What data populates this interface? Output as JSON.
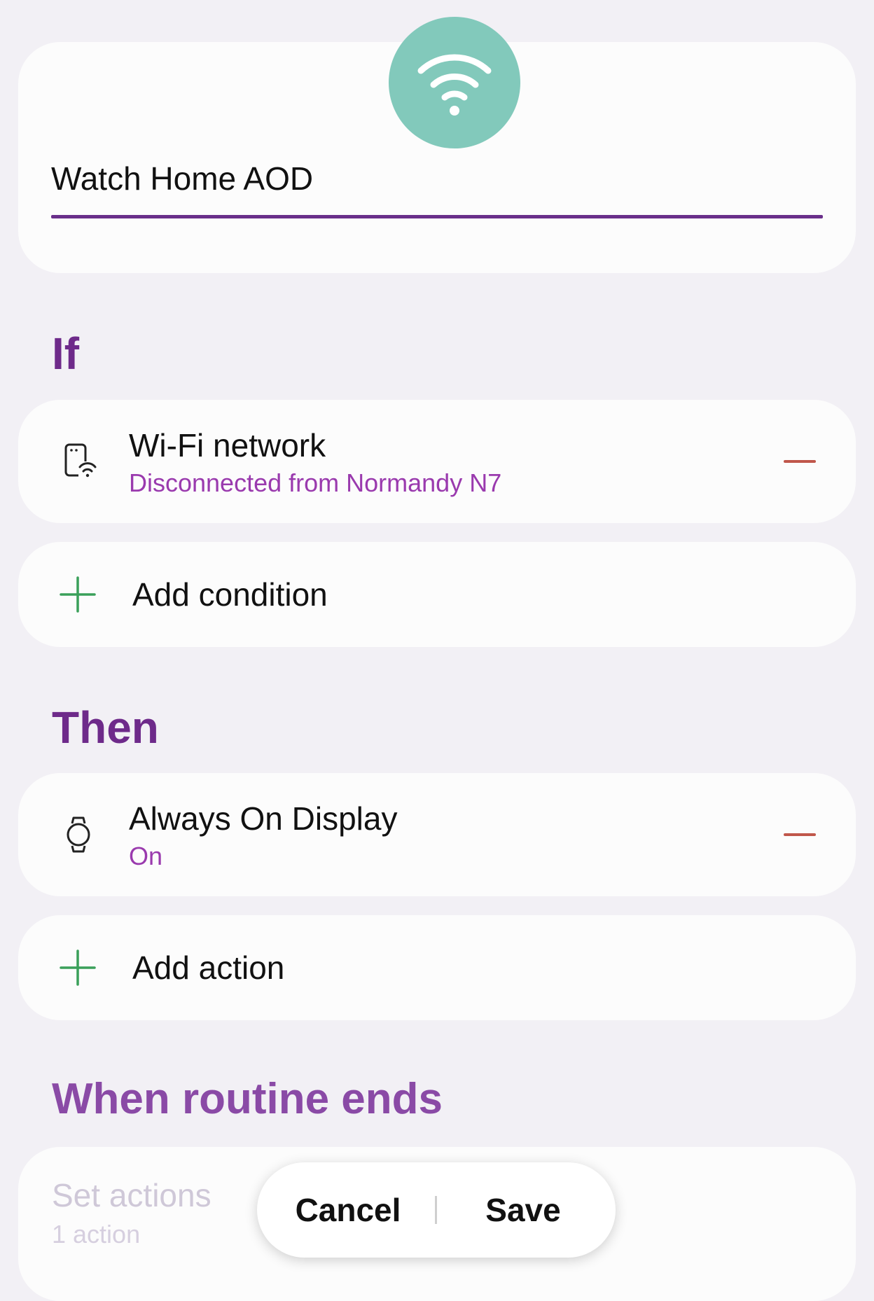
{
  "routine": {
    "icon": "wifi-icon",
    "icon_color": "#82c9bb",
    "name": "Watch Home AOD"
  },
  "if_section": {
    "heading": "If",
    "condition": {
      "icon": "phone-wifi-icon",
      "title": "Wi-Fi network",
      "subtitle": "Disconnected from Normandy N7"
    },
    "add_label": "Add condition"
  },
  "then_section": {
    "heading": "Then",
    "action": {
      "icon": "watch-icon",
      "title": "Always On Display",
      "subtitle": "On"
    },
    "add_label": "Add action"
  },
  "ends_section": {
    "heading": "When routine ends",
    "title": "Set actions",
    "subtitle": "1 action"
  },
  "bottom_bar": {
    "cancel_label": "Cancel",
    "save_label": "Save"
  },
  "colors": {
    "accent": "#6e2a8a",
    "subtitle": "#9a3aae",
    "remove": "#c0574b",
    "add": "#3aa05a"
  }
}
